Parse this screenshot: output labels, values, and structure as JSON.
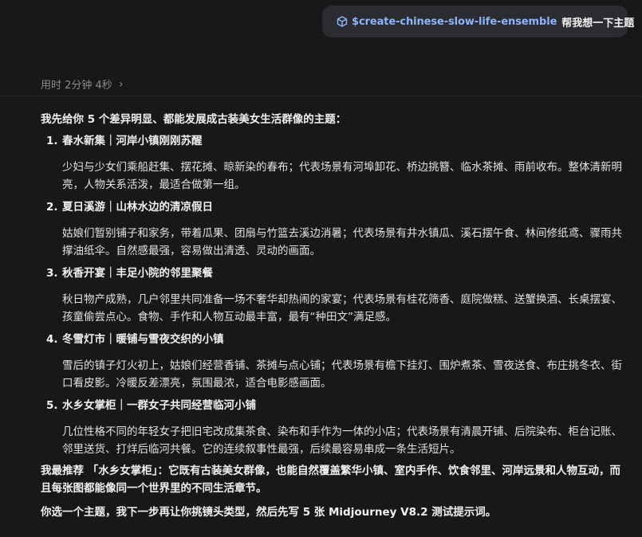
{
  "user_message": {
    "command": "$create-chinese-slow-life-ensemble",
    "text": "帮我想一下主题",
    "icon": "cube-icon",
    "command_color": "#8fb4f7"
  },
  "elapsed": {
    "label": "用时 2分钟 4秒",
    "chevron": "›"
  },
  "response": {
    "intro": "我先给你 5 个差异明显、都能发展成古装美女生活群像的主题：",
    "items": [
      {
        "num": "1.",
        "title": "春水新集｜河岸小镇刚刚苏醒",
        "body": "少妇与少女们乘船赶集、摆花摊、晾新染的春布；代表场景有河埠卸花、桥边挑簪、临水茶摊、雨前收布。整体清新明亮，人物关系活泼，最适合做第一组。"
      },
      {
        "num": "2.",
        "title": "夏日溪游｜山林水边的清凉假日",
        "body": "姑娘们暂别铺子和家务，带着瓜果、团扇与竹篮去溪边消暑；代表场景有井水镇瓜、溪石摆午食、林间修纸鸢、骤雨共撑油纸伞。自然感最强，容易做出清透、灵动的画面。"
      },
      {
        "num": "3.",
        "title": "秋香开宴｜丰足小院的邻里聚餐",
        "body": "秋日物产成熟，几户邻里共同准备一场不奢华却热闹的家宴；代表场景有桂花筛香、庭院做糕、送蟹换酒、长桌摆宴、孩童偷尝点心。食物、手作和人物互动最丰富，最有“种田文”满足感。"
      },
      {
        "num": "4.",
        "title": "冬雪灯市｜暖铺与雪夜交织的小镇",
        "body": "雪后的镇子灯火初上，姑娘们经营香铺、茶摊与点心铺；代表场景有檐下挂灯、围炉煮茶、雪夜送食、布庄挑冬衣、街口看皮影。冷暖反差漂亮，氛围最浓，适合电影感画面。"
      },
      {
        "num": "5.",
        "title": "水乡女掌柜｜一群女子共同经营临河小铺",
        "body": "几位性格不同的年轻女子把旧宅改成集茶食、染布和手作为一体的小店；代表场景有清晨开铺、后院染布、柜台记账、邻里送货、打烊后临河共餐。它的连续叙事性最强，后续最容易串成一条生活短片。"
      }
    ],
    "recommendation": "我最推荐 「水乡女掌柜」：它既有古装美女群像，也能自然覆盖繁华小镇、室内手作、饮食邻里、河岸远景和人物互动，而且每张图都能像同一个世界里的不同生活章节。",
    "next_step": "你选一个主题，我下一步再让你挑镜头类型，然后先写 5 张 Midjourney V8.2 测试提示词。"
  }
}
